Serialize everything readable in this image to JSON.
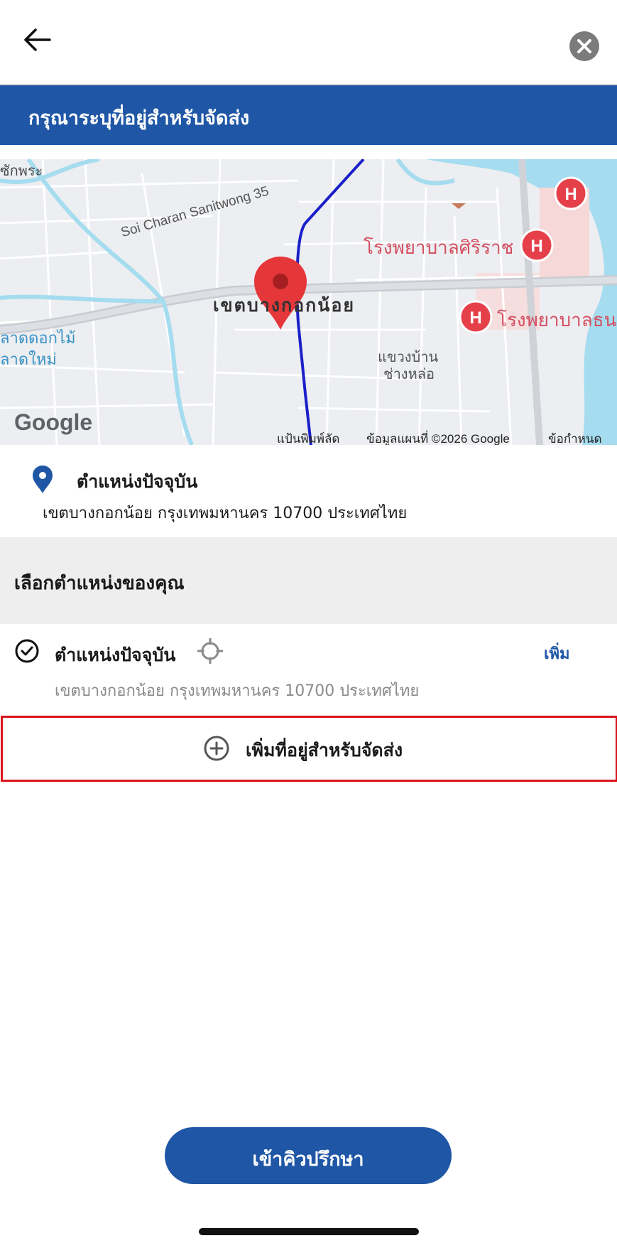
{
  "header": {
    "back_icon": "arrow-left-icon",
    "close_icon": "close-icon"
  },
  "banner": {
    "title": "กรุณาระบุที่อยู่สำหรับจัดส่ง"
  },
  "map": {
    "labels": {
      "top_left": "ซักพระ",
      "road": "Soi Charan Sanitwong 35",
      "district": "เขตบางกอกน้อย",
      "hospital_1": "โรงพยาบาลศิริราช",
      "hospital_2": "โรงพยาบาลธน",
      "market_1": "ลาดดอกไม้",
      "market_2": "ลาดใหม่",
      "subdistrict_1": "แขวงบ้าน",
      "subdistrict_2": "ช่างหล่อ"
    },
    "google_logo": "Google",
    "footer": {
      "shortcuts": "แป้นพิมพ์ลัด",
      "map_data": "ข้อมูลแผนที่ ©2026 Google",
      "terms": "ข้อกำหนด"
    },
    "colors": {
      "route": "#1a1fc9",
      "pin": "#e5373a",
      "hospital": "#e5404a",
      "water": "#a5dcef"
    }
  },
  "current_location": {
    "icon": "location-pin-icon",
    "title": "ตำแหน่งปัจจุบัน",
    "address": "เขตบางกอกน้อย กรุงเทพมหานคร 10700 ประเทศไทย"
  },
  "section": {
    "title": "เลือกตำแหน่งของคุณ"
  },
  "option": {
    "icon": "check-circle-icon",
    "title": "ตำแหน่งปัจจุบัน",
    "locate_icon": "crosshair-icon",
    "add_label": "เพิ่ม",
    "address": "เขตบางกอกน้อย กรุงเทพมหานคร 10700 ประเทศไทย"
  },
  "add_address": {
    "icon": "plus-circle-icon",
    "label": "เพิ่มที่อยู่สำหรับจัดส่ง"
  },
  "footer_button": {
    "label": "เข้าคิวปรึกษา"
  },
  "colors": {
    "primary": "#1f57a6",
    "highlight_border": "#d9141c"
  }
}
